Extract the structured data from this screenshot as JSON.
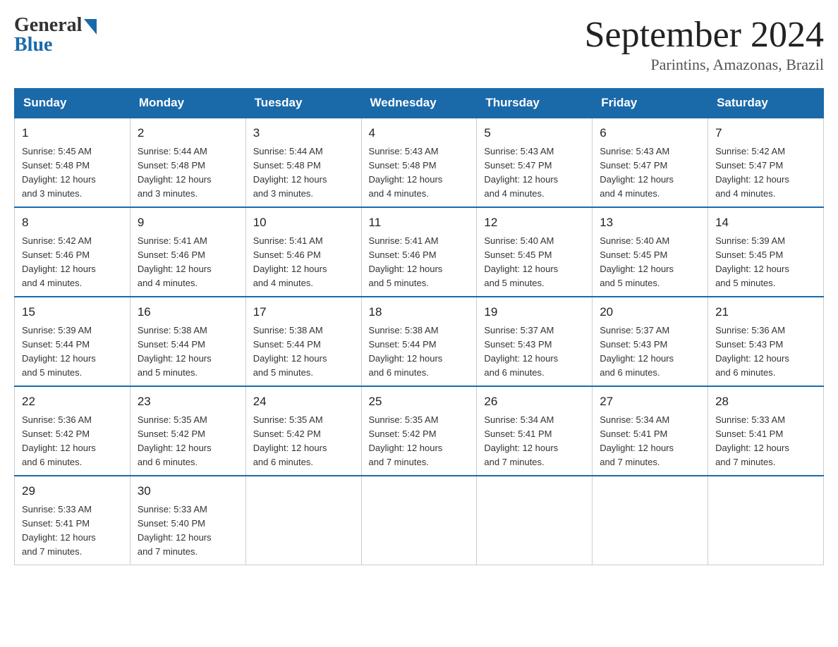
{
  "header": {
    "logo_general": "General",
    "logo_blue": "Blue",
    "month_title": "September 2024",
    "location": "Parintins, Amazonas, Brazil"
  },
  "calendar": {
    "days_of_week": [
      "Sunday",
      "Monday",
      "Tuesday",
      "Wednesday",
      "Thursday",
      "Friday",
      "Saturday"
    ],
    "weeks": [
      [
        {
          "day": "1",
          "sunrise": "5:45 AM",
          "sunset": "5:48 PM",
          "daylight": "12 hours and 3 minutes."
        },
        {
          "day": "2",
          "sunrise": "5:44 AM",
          "sunset": "5:48 PM",
          "daylight": "12 hours and 3 minutes."
        },
        {
          "day": "3",
          "sunrise": "5:44 AM",
          "sunset": "5:48 PM",
          "daylight": "12 hours and 3 minutes."
        },
        {
          "day": "4",
          "sunrise": "5:43 AM",
          "sunset": "5:48 PM",
          "daylight": "12 hours and 4 minutes."
        },
        {
          "day": "5",
          "sunrise": "5:43 AM",
          "sunset": "5:47 PM",
          "daylight": "12 hours and 4 minutes."
        },
        {
          "day": "6",
          "sunrise": "5:43 AM",
          "sunset": "5:47 PM",
          "daylight": "12 hours and 4 minutes."
        },
        {
          "day": "7",
          "sunrise": "5:42 AM",
          "sunset": "5:47 PM",
          "daylight": "12 hours and 4 minutes."
        }
      ],
      [
        {
          "day": "8",
          "sunrise": "5:42 AM",
          "sunset": "5:46 PM",
          "daylight": "12 hours and 4 minutes."
        },
        {
          "day": "9",
          "sunrise": "5:41 AM",
          "sunset": "5:46 PM",
          "daylight": "12 hours and 4 minutes."
        },
        {
          "day": "10",
          "sunrise": "5:41 AM",
          "sunset": "5:46 PM",
          "daylight": "12 hours and 4 minutes."
        },
        {
          "day": "11",
          "sunrise": "5:41 AM",
          "sunset": "5:46 PM",
          "daylight": "12 hours and 5 minutes."
        },
        {
          "day": "12",
          "sunrise": "5:40 AM",
          "sunset": "5:45 PM",
          "daylight": "12 hours and 5 minutes."
        },
        {
          "day": "13",
          "sunrise": "5:40 AM",
          "sunset": "5:45 PM",
          "daylight": "12 hours and 5 minutes."
        },
        {
          "day": "14",
          "sunrise": "5:39 AM",
          "sunset": "5:45 PM",
          "daylight": "12 hours and 5 minutes."
        }
      ],
      [
        {
          "day": "15",
          "sunrise": "5:39 AM",
          "sunset": "5:44 PM",
          "daylight": "12 hours and 5 minutes."
        },
        {
          "day": "16",
          "sunrise": "5:38 AM",
          "sunset": "5:44 PM",
          "daylight": "12 hours and 5 minutes."
        },
        {
          "day": "17",
          "sunrise": "5:38 AM",
          "sunset": "5:44 PM",
          "daylight": "12 hours and 5 minutes."
        },
        {
          "day": "18",
          "sunrise": "5:38 AM",
          "sunset": "5:44 PM",
          "daylight": "12 hours and 6 minutes."
        },
        {
          "day": "19",
          "sunrise": "5:37 AM",
          "sunset": "5:43 PM",
          "daylight": "12 hours and 6 minutes."
        },
        {
          "day": "20",
          "sunrise": "5:37 AM",
          "sunset": "5:43 PM",
          "daylight": "12 hours and 6 minutes."
        },
        {
          "day": "21",
          "sunrise": "5:36 AM",
          "sunset": "5:43 PM",
          "daylight": "12 hours and 6 minutes."
        }
      ],
      [
        {
          "day": "22",
          "sunrise": "5:36 AM",
          "sunset": "5:42 PM",
          "daylight": "12 hours and 6 minutes."
        },
        {
          "day": "23",
          "sunrise": "5:35 AM",
          "sunset": "5:42 PM",
          "daylight": "12 hours and 6 minutes."
        },
        {
          "day": "24",
          "sunrise": "5:35 AM",
          "sunset": "5:42 PM",
          "daylight": "12 hours and 6 minutes."
        },
        {
          "day": "25",
          "sunrise": "5:35 AM",
          "sunset": "5:42 PM",
          "daylight": "12 hours and 7 minutes."
        },
        {
          "day": "26",
          "sunrise": "5:34 AM",
          "sunset": "5:41 PM",
          "daylight": "12 hours and 7 minutes."
        },
        {
          "day": "27",
          "sunrise": "5:34 AM",
          "sunset": "5:41 PM",
          "daylight": "12 hours and 7 minutes."
        },
        {
          "day": "28",
          "sunrise": "5:33 AM",
          "sunset": "5:41 PM",
          "daylight": "12 hours and 7 minutes."
        }
      ],
      [
        {
          "day": "29",
          "sunrise": "5:33 AM",
          "sunset": "5:41 PM",
          "daylight": "12 hours and 7 minutes."
        },
        {
          "day": "30",
          "sunrise": "5:33 AM",
          "sunset": "5:40 PM",
          "daylight": "12 hours and 7 minutes."
        },
        null,
        null,
        null,
        null,
        null
      ]
    ],
    "sunrise_label": "Sunrise:",
    "sunset_label": "Sunset:",
    "daylight_label": "Daylight:"
  }
}
